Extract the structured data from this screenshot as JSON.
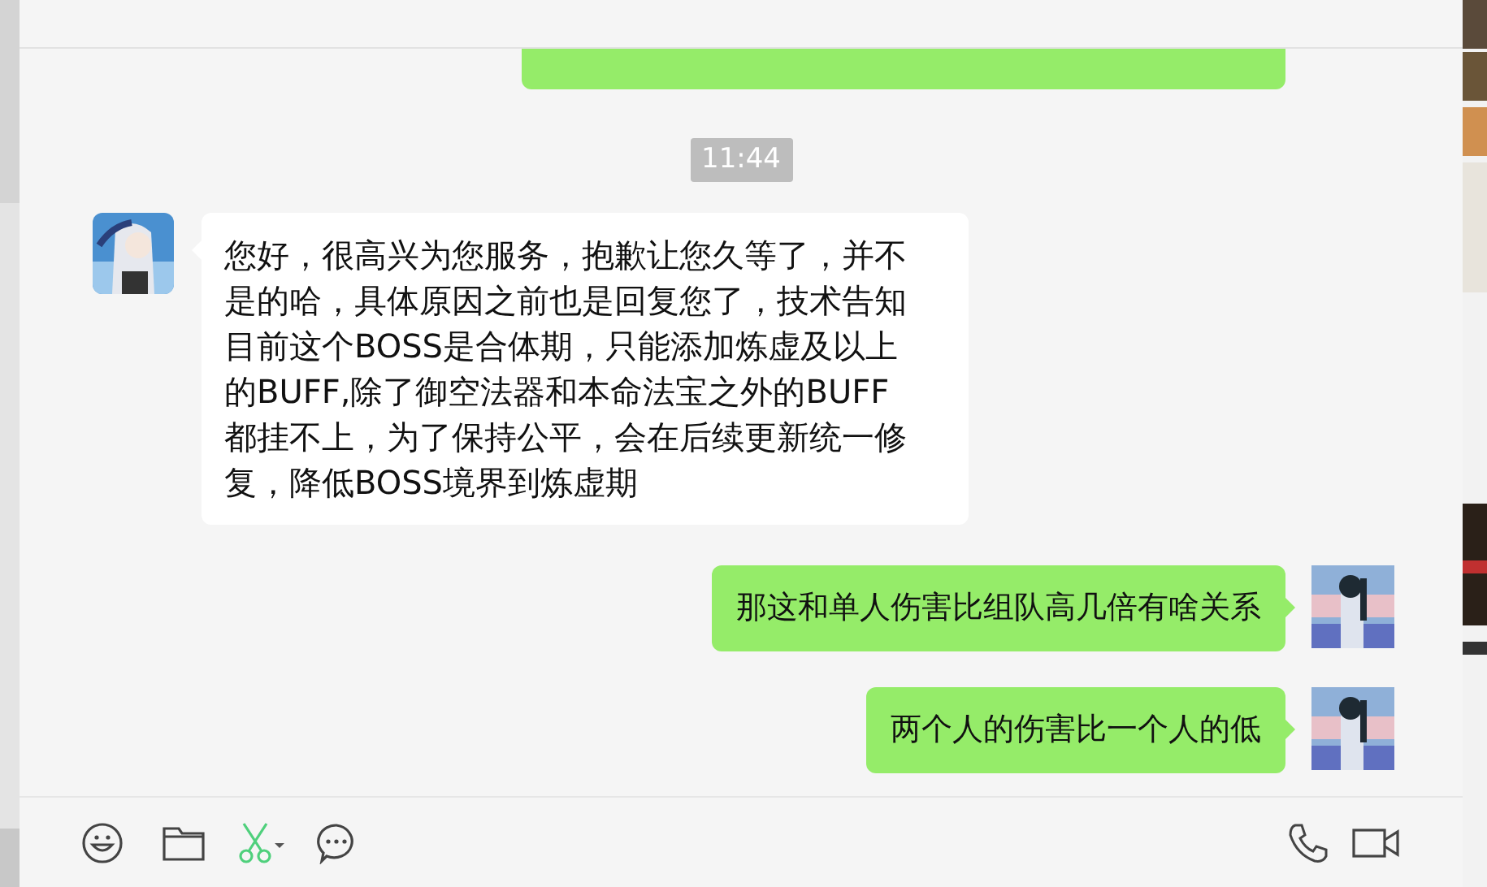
{
  "messages": [
    {
      "kind": "sent_cut"
    },
    {
      "kind": "time",
      "text": "11:44"
    },
    {
      "kind": "received",
      "text": "您好，很高兴为您服务，抱歉让您久等了，并不是的哈，具体原因之前也是回复您了，技术告知目前这个BOSS是合体期，只能添加炼虚及以上的BUFF,除了御空法器和本命法宝之外的BUFF都挂不上，为了保持公平，会在后续更新统一修复，降低BOSS境界到炼虚期"
    },
    {
      "kind": "sent",
      "text": "那这和单人伤害比组队高几倍有啥关系"
    },
    {
      "kind": "sent",
      "text": "两个人的伤害比一个人的低"
    }
  ]
}
